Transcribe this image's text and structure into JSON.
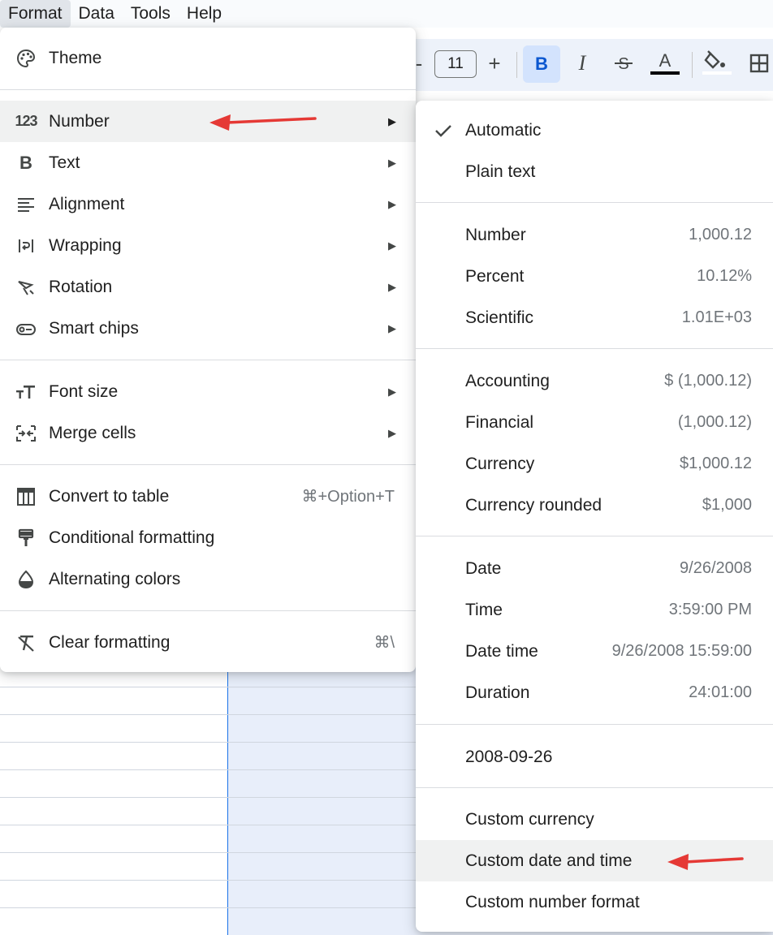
{
  "menubar": {
    "items": [
      {
        "label": "Format",
        "active": true
      },
      {
        "label": "Data"
      },
      {
        "label": "Tools"
      },
      {
        "label": "Help"
      }
    ]
  },
  "toolbar": {
    "font_size": "11",
    "minus": "-",
    "plus": "+",
    "bold": "B",
    "italic": "I"
  },
  "format_menu": {
    "theme": "Theme",
    "number": "Number",
    "text": "Text",
    "alignment": "Alignment",
    "wrapping": "Wrapping",
    "rotation": "Rotation",
    "smart_chips": "Smart chips",
    "font_size": "Font size",
    "merge_cells": "Merge cells",
    "convert_to_table": "Convert to table",
    "convert_to_table_shortcut": "⌘+Option+T",
    "conditional_formatting": "Conditional formatting",
    "alternating_colors": "Alternating colors",
    "clear_formatting": "Clear formatting",
    "clear_formatting_shortcut": "⌘\\",
    "submenu_arrow": "▶",
    "number_icon_text": "123"
  },
  "number_menu": {
    "automatic": "Automatic",
    "plain_text": "Plain text",
    "number": {
      "label": "Number",
      "preview": "1,000.12"
    },
    "percent": {
      "label": "Percent",
      "preview": "10.12%"
    },
    "scientific": {
      "label": "Scientific",
      "preview": "1.01E+03"
    },
    "accounting": {
      "label": "Accounting",
      "preview": "$ (1,000.12)"
    },
    "financial": {
      "label": "Financial",
      "preview": "(1,000.12)"
    },
    "currency": {
      "label": "Currency",
      "preview": "$1,000.12"
    },
    "currency_rounded": {
      "label": "Currency rounded",
      "preview": "$1,000"
    },
    "date": {
      "label": "Date",
      "preview": "9/26/2008"
    },
    "time": {
      "label": "Time",
      "preview": "3:59:00 PM"
    },
    "date_time": {
      "label": "Date time",
      "preview": "9/26/2008 15:59:00"
    },
    "duration": {
      "label": "Duration",
      "preview": "24:01:00"
    },
    "iso_date": "2008-09-26",
    "custom_currency": "Custom currency",
    "custom_date_time": "Custom date and time",
    "custom_number_format": "Custom number format"
  },
  "colors": {
    "annotation_arrow": "#e53935",
    "selection": "#d3e3fd",
    "hover": "#f0f1f1"
  }
}
